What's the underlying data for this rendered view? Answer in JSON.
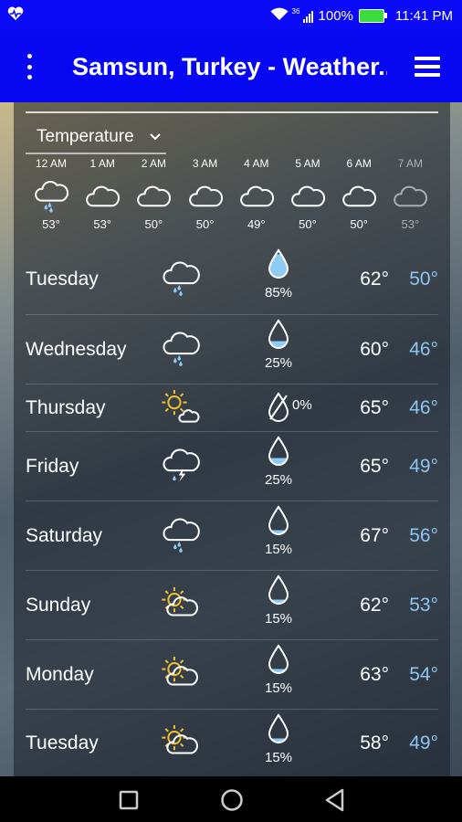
{
  "status_bar": {
    "signal_label": "36",
    "battery": "100%",
    "time": "11:41 PM"
  },
  "app_bar": {
    "title": "Samsun, Turkey - Weather..."
  },
  "dropdown": {
    "selected": "Temperature"
  },
  "hourly": [
    {
      "time": "12 AM",
      "icon": "cloud-rain-icon",
      "temp": "53°"
    },
    {
      "time": "1 AM",
      "icon": "cloud-icon",
      "temp": "53°"
    },
    {
      "time": "2 AM",
      "icon": "cloud-icon",
      "temp": "50°"
    },
    {
      "time": "3 AM",
      "icon": "cloud-icon",
      "temp": "50°"
    },
    {
      "time": "4 AM",
      "icon": "cloud-icon",
      "temp": "49°"
    },
    {
      "time": "5 AM",
      "icon": "cloud-icon",
      "temp": "50°"
    },
    {
      "time": "6 AM",
      "icon": "cloud-icon",
      "temp": "50°"
    },
    {
      "time": "7 AM",
      "icon": "cloud-icon",
      "temp": "53°"
    }
  ],
  "daily": [
    {
      "day": "Tuesday",
      "icon": "cloud-rain-icon",
      "precip": "85%",
      "precip_level": 0.85,
      "hi": "62°",
      "lo": "50°"
    },
    {
      "day": "Wednesday",
      "icon": "cloud-rain-icon",
      "precip": "25%",
      "precip_level": 0.25,
      "hi": "60°",
      "lo": "46°"
    },
    {
      "day": "Thursday",
      "icon": "sun-cloud-icon",
      "precip": "0%",
      "precip_level": 0,
      "hi": "65°",
      "lo": "46°"
    },
    {
      "day": "Friday",
      "icon": "thunderstorm-icon",
      "precip": "25%",
      "precip_level": 0.25,
      "hi": "65°",
      "lo": "49°"
    },
    {
      "day": "Saturday",
      "icon": "cloud-rain-icon",
      "precip": "15%",
      "precip_level": 0.15,
      "hi": "67°",
      "lo": "56°"
    },
    {
      "day": "Sunday",
      "icon": "partly-cloudy-icon",
      "precip": "15%",
      "precip_level": 0.15,
      "hi": "62°",
      "lo": "53°"
    },
    {
      "day": "Monday",
      "icon": "partly-cloudy-icon",
      "precip": "15%",
      "precip_level": 0.15,
      "hi": "63°",
      "lo": "54°"
    },
    {
      "day": "Tuesday",
      "icon": "partly-cloudy-icon",
      "precip": "15%",
      "precip_level": 0.15,
      "hi": "58°",
      "lo": "49°"
    }
  ],
  "colors": {
    "appbar": "#0707f2",
    "low_temp": "#8ec5f2",
    "sun": "#f3c02f",
    "rain": "#8ecbf5"
  },
  "nav_bar": [
    "square-icon",
    "circle-icon",
    "triangle-back-icon"
  ]
}
